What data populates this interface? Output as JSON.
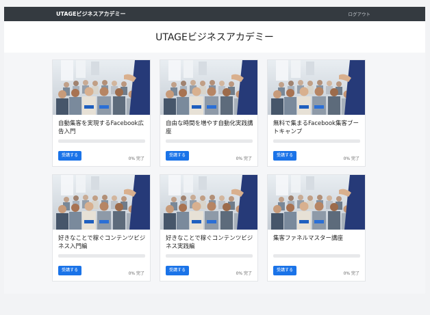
{
  "header": {
    "brand": "UTAGEビジネスアカデミー",
    "logout_label": "ログアウト"
  },
  "hero": {
    "title": "UTAGEビジネスアカデミー"
  },
  "thumbnail": {
    "icon": "seminar-audience-photo"
  },
  "colors": {
    "accent": "#1a73e8",
    "topbar": "#343a40"
  },
  "courses": [
    {
      "title": "自動集客を実現するFacebook広告入門",
      "button_label": "受講する",
      "progress_label": "0% 完了",
      "progress": 0
    },
    {
      "title": "自由な時間を増やす自動化実践講座",
      "button_label": "受講する",
      "progress_label": "0% 完了",
      "progress": 0
    },
    {
      "title": "無料で集まるFacebook集客ブートキャンプ",
      "button_label": "受講する",
      "progress_label": "0% 完了",
      "progress": 0
    },
    {
      "title": "好きなことで稼ぐコンテンツビジネス入門編",
      "button_label": "受講する",
      "progress_label": "0% 完了",
      "progress": 0
    },
    {
      "title": "好きなことで稼ぐコンテンツビジネス実践編",
      "button_label": "受講する",
      "progress_label": "0% 完了",
      "progress": 0
    },
    {
      "title": "集客ファネルマスター講座",
      "button_label": "受講する",
      "progress_label": "0% 完了",
      "progress": 0
    }
  ]
}
